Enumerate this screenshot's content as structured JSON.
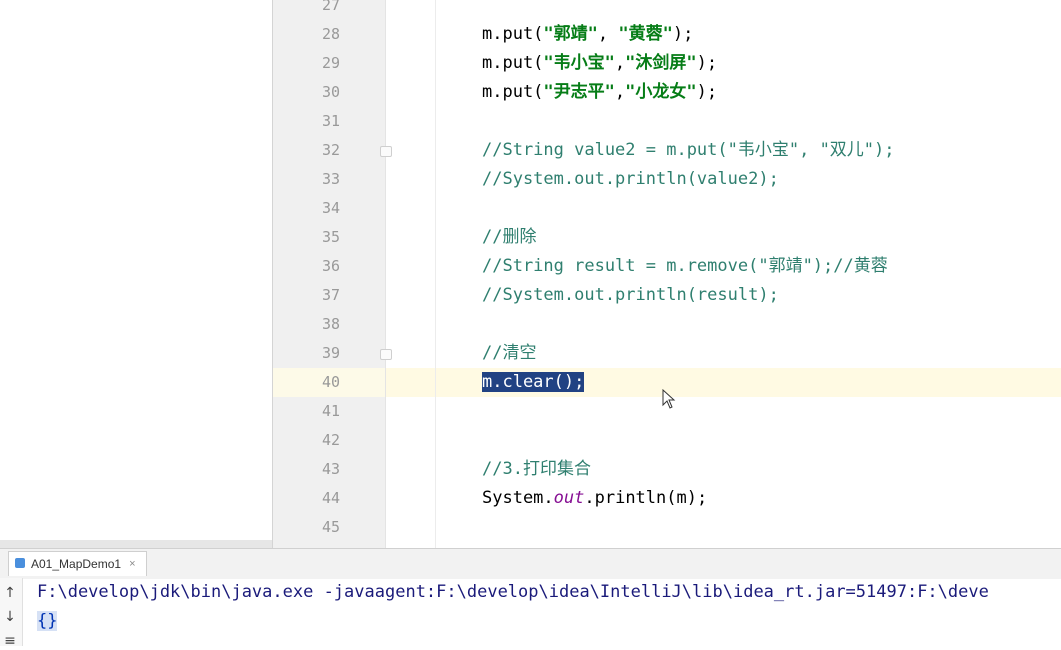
{
  "editor": {
    "line_numbers": [
      "27",
      "28",
      "29",
      "30",
      "31",
      "32",
      "33",
      "34",
      "35",
      "36",
      "37",
      "38",
      "39",
      "40",
      "41",
      "42",
      "43",
      "44",
      "45"
    ],
    "code": {
      "l28": {
        "a": "m.put(",
        "b": "\"郭靖\"",
        "c": ", ",
        "d": "\"黄蓉\"",
        "e": ");"
      },
      "l29": {
        "a": "m.put(",
        "b": "\"韦小宝\"",
        "c": ",",
        "d": "\"沐剑屏\"",
        "e": ");"
      },
      "l30": {
        "a": "m.put(",
        "b": "\"尹志平\"",
        "c": ",",
        "d": "\"小龙女\"",
        "e": ");"
      },
      "l32": "//String value2 = m.put(\"韦小宝\", \"双儿\");",
      "l33": "//System.out.println(value2);",
      "l35": "//删除",
      "l36": "//String result = m.remove(\"郭靖\");//黄蓉",
      "l37": "//System.out.println(result);",
      "l39": "//清空",
      "l40": "m.clear();",
      "l43": "//3.打印集合",
      "l44": {
        "a": "System.",
        "b": "out",
        "c": ".println(m);"
      }
    }
  },
  "run_panel": {
    "tab_label": "A01_MapDemo1",
    "tab_close": "×",
    "command_line": "F:\\develop\\jdk\\bin\\java.exe -javaagent:F:\\develop\\idea\\IntelliJ\\lib\\idea_rt.jar=51497:F:\\deve",
    "output": "{}",
    "side_buttons": [
      "↑",
      "↓",
      "≡"
    ]
  },
  "colors": {
    "selection": "#214283",
    "string": "#067d17",
    "comment": "#2f7f6f",
    "current_line": "#fffae3"
  }
}
